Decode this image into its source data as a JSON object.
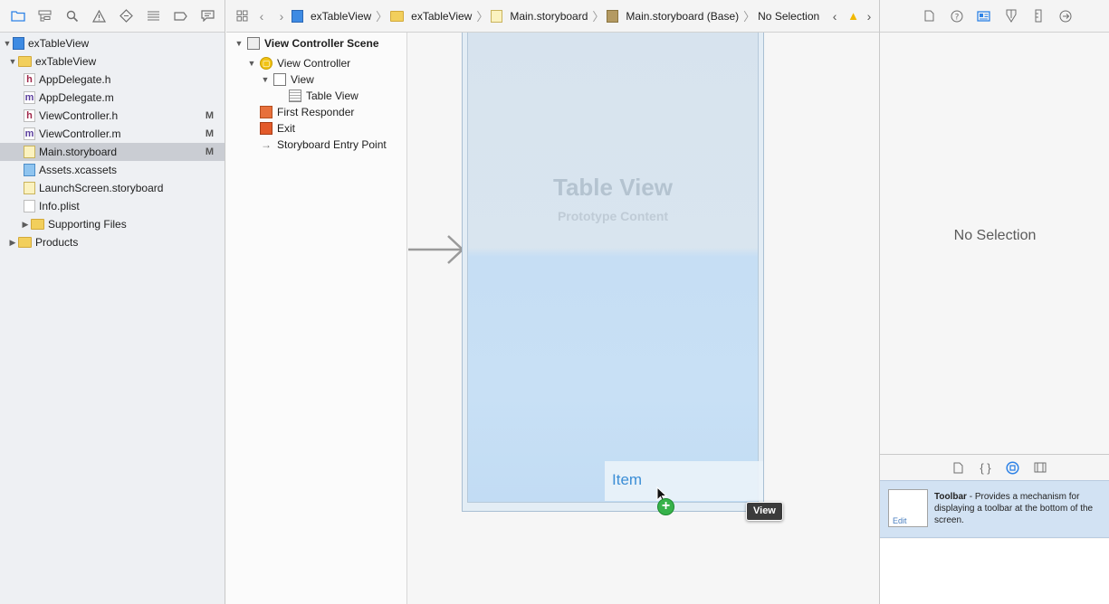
{
  "navigator": {
    "toolbar_icons": [
      "folder-icon",
      "hierarchy-icon",
      "search-icon",
      "warning-icon",
      "test-icon",
      "debug-icon",
      "breakpoint-icon",
      "report-icon"
    ],
    "items": [
      {
        "label": "exTableView",
        "depth": 0,
        "icon": "project-icon",
        "disclosure": "open",
        "badge": ""
      },
      {
        "label": "exTableView",
        "depth": 1,
        "icon": "folder-icon",
        "disclosure": "open",
        "badge": ""
      },
      {
        "label": "AppDelegate.h",
        "depth": 2,
        "icon": "header-file-icon",
        "glyph": "h",
        "disclosure": "",
        "badge": ""
      },
      {
        "label": "AppDelegate.m",
        "depth": 2,
        "icon": "implementation-file-icon",
        "glyph": "m",
        "disclosure": "",
        "badge": ""
      },
      {
        "label": "ViewController.h",
        "depth": 2,
        "icon": "header-file-icon",
        "glyph": "h",
        "disclosure": "",
        "badge": "M"
      },
      {
        "label": "ViewController.m",
        "depth": 2,
        "icon": "implementation-file-icon",
        "glyph": "m",
        "disclosure": "",
        "badge": "M"
      },
      {
        "label": "Main.storyboard",
        "depth": 2,
        "icon": "storyboard-file-icon",
        "disclosure": "",
        "badge": "M",
        "selected": true
      },
      {
        "label": "Assets.xcassets",
        "depth": 2,
        "icon": "asset-catalog-icon",
        "disclosure": "",
        "badge": ""
      },
      {
        "label": "LaunchScreen.storyboard",
        "depth": 2,
        "icon": "storyboard-file-icon",
        "disclosure": "",
        "badge": ""
      },
      {
        "label": "Info.plist",
        "depth": 2,
        "icon": "plist-file-icon",
        "disclosure": "",
        "badge": ""
      },
      {
        "label": "Supporting Files",
        "depth": 2,
        "icon": "folder-icon",
        "disclosure": "closed",
        "badge": ""
      },
      {
        "label": "Products",
        "depth": 1,
        "icon": "folder-icon",
        "disclosure": "closed",
        "badge": ""
      }
    ]
  },
  "jumpbar": {
    "crumbs": [
      {
        "label": "exTableView",
        "icon": "project-icon"
      },
      {
        "label": "exTableView",
        "icon": "folder-icon"
      },
      {
        "label": "Main.storyboard",
        "icon": "storyboard-file-icon"
      },
      {
        "label": "Main.storyboard (Base)",
        "icon": "storyboard-base-icon"
      },
      {
        "label": "No Selection",
        "icon": ""
      }
    ]
  },
  "outline": {
    "items": [
      {
        "label": "View Controller Scene",
        "depth": 0,
        "icon": "scene-icon",
        "disclosure": "open",
        "bold": true
      },
      {
        "label": "View Controller",
        "depth": 1,
        "icon": "view-controller-icon",
        "disclosure": "open"
      },
      {
        "label": "View",
        "depth": 2,
        "icon": "view-icon",
        "disclosure": "open"
      },
      {
        "label": "Table View",
        "depth": 3,
        "icon": "table-view-icon",
        "disclosure": ""
      },
      {
        "label": "First Responder",
        "depth": 1,
        "icon": "first-responder-icon",
        "disclosure": ""
      },
      {
        "label": "Exit",
        "depth": 1,
        "icon": "exit-icon",
        "disclosure": ""
      },
      {
        "label": "Storyboard Entry Point",
        "depth": 1,
        "icon": "entry-point-arrow-icon",
        "disclosure": ""
      }
    ]
  },
  "canvas": {
    "table_title": "Table View",
    "table_subtitle": "Prototype Content",
    "drag_item_label": "Item",
    "drop_target_tag": "View"
  },
  "inspector": {
    "toolbar_icons": [
      "file-inspector-icon",
      "quick-help-icon",
      "identity-inspector-icon",
      "attributes-inspector-icon",
      "size-inspector-icon",
      "connections-inspector-icon"
    ],
    "no_selection": "No Selection",
    "library_icons": [
      "file-template-icon",
      "code-snippet-icon",
      "object-library-icon",
      "media-library-icon"
    ],
    "library_item": {
      "title": "Toolbar",
      "description": " - Provides a mechanism for displaying a toolbar at the bottom of the screen.",
      "edit_label": "Edit"
    }
  },
  "colors": {
    "accent": "#2d82e6",
    "selection": "#cacdd3",
    "library_selection": "#d2e2f3",
    "warning": "#f1b800",
    "add_badge": "#37b24a"
  }
}
